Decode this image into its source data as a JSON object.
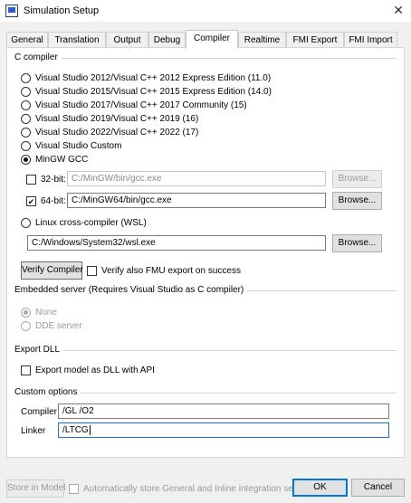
{
  "window": {
    "title": "Simulation Setup",
    "close_glyph": "✕"
  },
  "tabs": [
    {
      "label": "General"
    },
    {
      "label": "Translation"
    },
    {
      "label": "Output"
    },
    {
      "label": "Debug"
    },
    {
      "label": "Compiler",
      "active": true
    },
    {
      "label": "Realtime"
    },
    {
      "label": "FMI Export"
    },
    {
      "label": "FMI Import"
    }
  ],
  "c_compiler": {
    "group_label": "C compiler",
    "options": [
      {
        "label": "Visual Studio 2012/Visual C++ 2012 Express Edition (11.0)",
        "selected": false
      },
      {
        "label": "Visual Studio 2015/Visual C++ 2015 Express Edition (14.0)",
        "selected": false
      },
      {
        "label": "Visual Studio 2017/Visual C++ 2017 Community (15)",
        "selected": false
      },
      {
        "label": "Visual Studio 2019/Visual C++ 2019 (16)",
        "selected": false
      },
      {
        "label": "Visual Studio 2022/Visual C++ 2022 (17)",
        "selected": false
      },
      {
        "label": "Visual Studio Custom",
        "selected": false
      },
      {
        "label": "MinGW GCC",
        "selected": true
      }
    ],
    "bit32": {
      "label": "32-bit:",
      "checked": false,
      "path": "C:/MinGW/bin/gcc.exe",
      "browse": "Browse..."
    },
    "bit64": {
      "label": "64-bit:",
      "checked": true,
      "path": "C:/MinGW64/bin/gcc.exe",
      "browse": "Browse..."
    },
    "linux": {
      "label": "Linux cross-compiler (WSL)",
      "selected": false,
      "path": "C:/Windows/System32/wsl.exe",
      "browse": "Browse..."
    },
    "verify_button": "Verify Compiler",
    "verify_fmu_label": "Verify also FMU export on success"
  },
  "embedded_server": {
    "group_label": "Embedded server (Requires Visual Studio as C compiler)",
    "none_label": "None",
    "dde_label": "DDE server"
  },
  "export_dll": {
    "group_label": "Export DLL",
    "checkbox_label": "Export model as DLL with API"
  },
  "custom_options": {
    "group_label": "Custom options",
    "compiler_label": "Compiler",
    "compiler_value": "/GL /O2",
    "linker_label": "Linker",
    "linker_value": "/LTCG"
  },
  "footer": {
    "store_button": "Store in Model",
    "auto_store_label": "Automatically store General and Inline integration settings",
    "ok": "OK",
    "cancel": "Cancel"
  }
}
